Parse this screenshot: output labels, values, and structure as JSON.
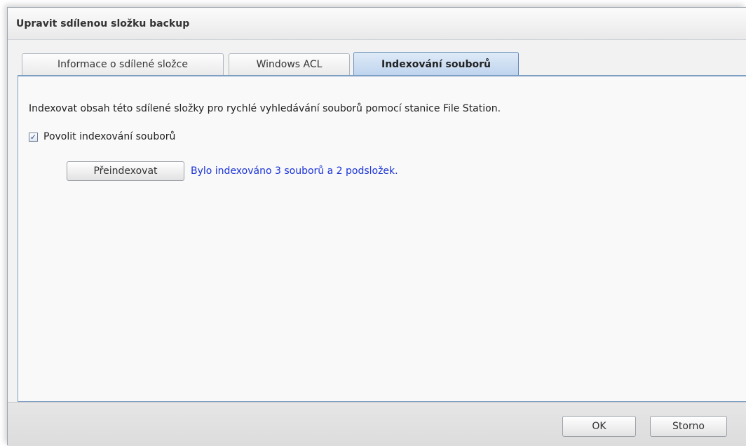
{
  "dialog": {
    "title": "Upravit sdílenou složku backup"
  },
  "tabs": [
    {
      "label": "Informace o sdílené složce",
      "active": false
    },
    {
      "label": "Windows ACL",
      "active": false
    },
    {
      "label": "Indexování souborů",
      "active": true
    }
  ],
  "content": {
    "description": "Indexovat obsah této sdílené složky pro rychlé vyhledávání souborů pomocí stanice File Station.",
    "enable_indexing": {
      "label": "Povolit indexování souborů",
      "checked": true
    },
    "reindex_button": "Přeindexovat",
    "status_text": "Bylo indexováno 3 souborů a 2 podsložek.",
    "status_color": "#1a33d8"
  },
  "footer": {
    "ok_label": "OK",
    "cancel_label": "Storno"
  }
}
